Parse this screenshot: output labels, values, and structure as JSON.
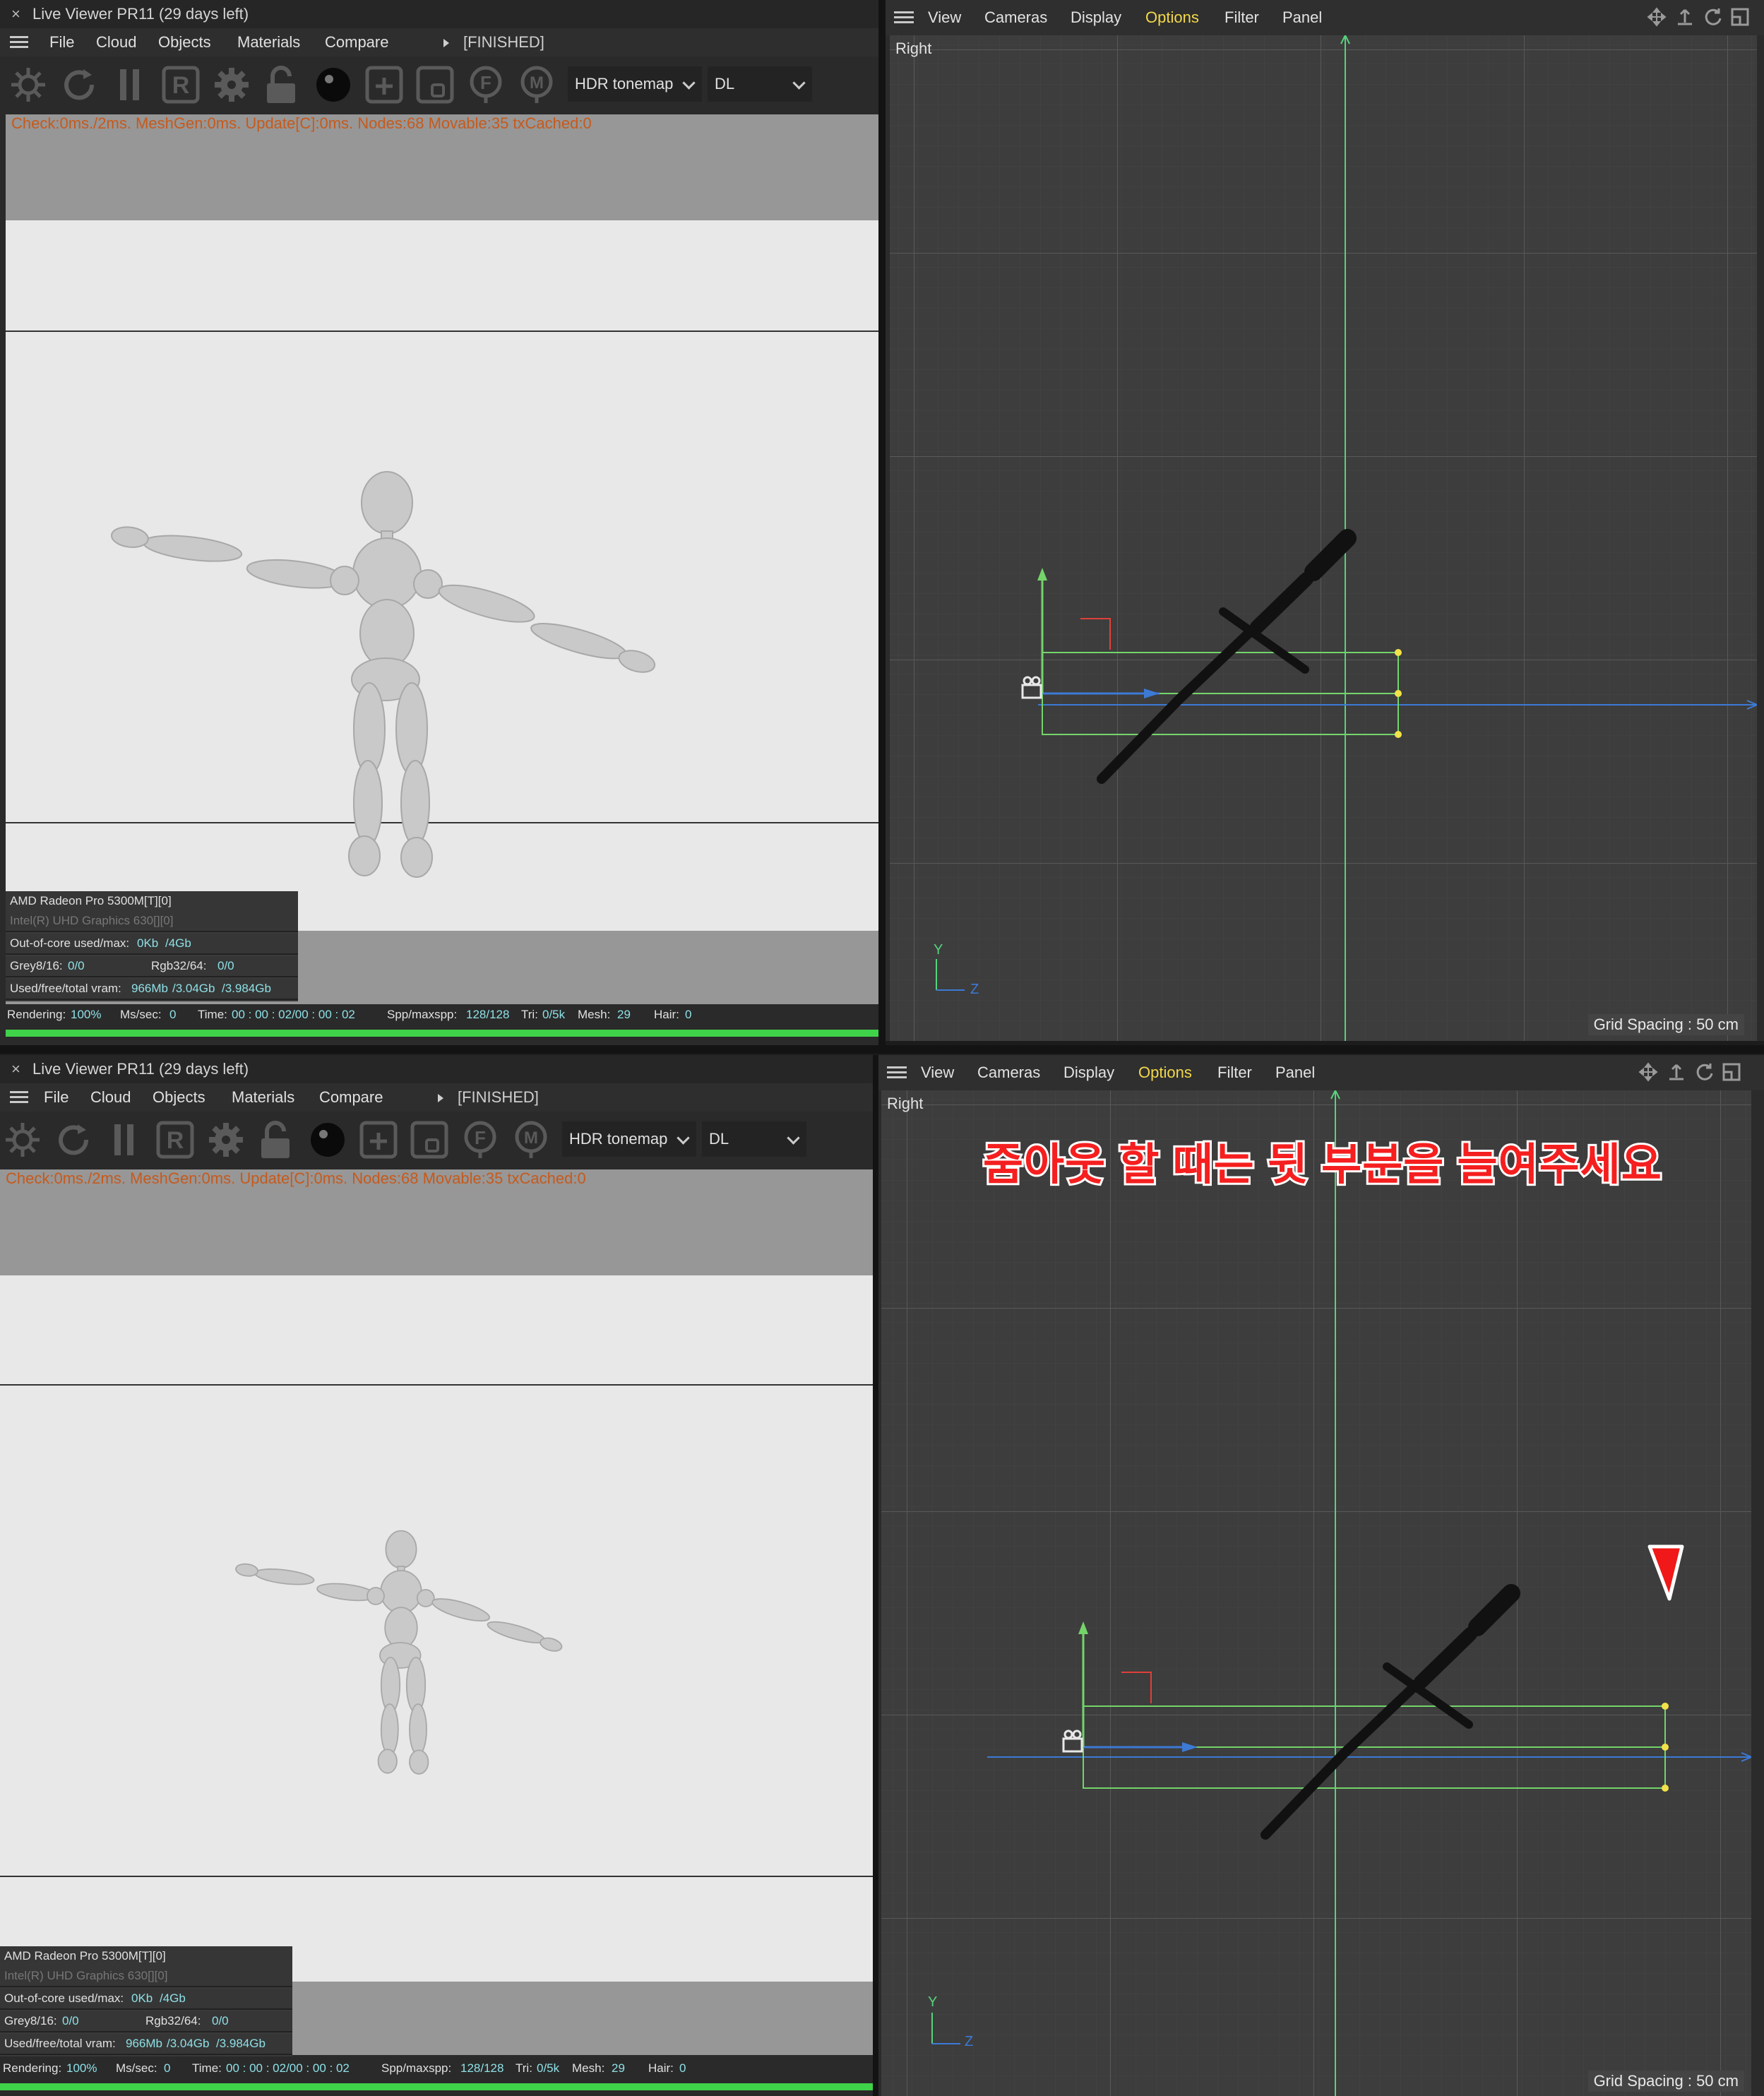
{
  "top": {
    "viewer": {
      "close_glyph": "×",
      "title": "Live Viewer PR11 (29 days left)",
      "menu": [
        "File",
        "Cloud",
        "Objects",
        "Materials",
        "Compare"
      ],
      "status": "[FINISHED]",
      "tonemap": "HDR tonemap",
      "mode": "DL",
      "check": "Check:0ms./2ms. MeshGen:0ms. Update[C]:0ms. Nodes:68 Movable:35 txCached:0",
      "gpu1": "AMD Radeon Pro 5300M[T][0]",
      "gpu2": "Intel(R) UHD Graphics 630[][0]",
      "ooc_label": "Out-of-core used/max:",
      "ooc_value": "0Kb",
      "ooc_max": "/4Gb",
      "grey_label": "Grey8/16:",
      "grey_value": "0/0",
      "rgb_label": "Rgb32/64:",
      "rgb_value": "0/0",
      "vram_label": "Used/free/total vram:",
      "vram_used": "966Mb",
      "vram_free": "/3.04Gb",
      "vram_total": "/3.984Gb",
      "rendering_label": "Rendering:",
      "rendering_value": "100%",
      "ms_label": "Ms/sec:",
      "ms_value": "0",
      "time_label": "Time:",
      "time_value": "00 : 00 : 02/00 : 00 : 02",
      "spp_label": "Spp/maxspp:",
      "spp_value": "128/128",
      "tri_label": "Tri:",
      "tri_value": "0/5k",
      "mesh_label": "Mesh:",
      "mesh_value": "29",
      "hair_label": "Hair:",
      "hair_value": "0",
      "progress": 1.0
    },
    "viewport": {
      "menu": [
        "View",
        "Cameras",
        "Display",
        "Options",
        "Filter",
        "Panel"
      ],
      "label": "Right",
      "grid_spacing": "Grid Spacing : 50 cm",
      "axis_y": "Y",
      "axis_z": "Z"
    }
  },
  "bottom": {
    "viewer": {
      "close_glyph": "×",
      "title": "Live Viewer PR11 (29 days left)",
      "menu": [
        "File",
        "Cloud",
        "Objects",
        "Materials",
        "Compare"
      ],
      "status": "[FINISHED]",
      "tonemap": "HDR tonemap",
      "mode": "DL",
      "check": "Check:0ms./2ms. MeshGen:0ms. Update[C]:0ms. Nodes:68 Movable:35 txCached:0",
      "gpu1": "AMD Radeon Pro 5300M[T][0]",
      "gpu2": "Intel(R) UHD Graphics 630[][0]",
      "ooc_label": "Out-of-core used/max:",
      "ooc_value": "0Kb",
      "ooc_max": "/4Gb",
      "grey_label": "Grey8/16:",
      "grey_value": "0/0",
      "rgb_label": "Rgb32/64:",
      "rgb_value": "0/0",
      "vram_label": "Used/free/total vram:",
      "vram_used": "966Mb",
      "vram_free": "/3.04Gb",
      "vram_total": "/3.984Gb",
      "rendering_label": "Rendering:",
      "rendering_value": "100%",
      "ms_label": "Ms/sec:",
      "ms_value": "0",
      "time_label": "Time:",
      "time_value": "00 : 00 : 02/00 : 00 : 02",
      "spp_label": "Spp/maxspp:",
      "spp_value": "128/128",
      "tri_label": "Tri:",
      "tri_value": "0/5k",
      "mesh_label": "Mesh:",
      "mesh_value": "29",
      "hair_label": "Hair:",
      "hair_value": "0",
      "progress": 1.0
    },
    "viewport": {
      "menu": [
        "View",
        "Cameras",
        "Display",
        "Options",
        "Filter",
        "Panel"
      ],
      "label": "Right",
      "grid_spacing": "Grid Spacing : 50 cm",
      "axis_y": "Y",
      "axis_z": "Z",
      "annotation": "줌아웃 할 때는 뒷 부분을 늘여주세요"
    }
  },
  "colors": {
    "accent_option": "#f2d94a",
    "check_text": "#c65a1c",
    "stat_value": "#8ee0e6",
    "progress": "#3fd34a",
    "annotation": "#f51f1f"
  },
  "icons": [
    "aperture-icon",
    "refresh-icon",
    "pause-icon",
    "region-icon",
    "settings-gear-icon",
    "lock-icon",
    "sphere-icon",
    "add-icon",
    "clay-icon",
    "focus-icon",
    "pick-icon",
    "move-view-icon",
    "pan-view-icon",
    "rotate-view-icon",
    "maximize-view-icon"
  ]
}
